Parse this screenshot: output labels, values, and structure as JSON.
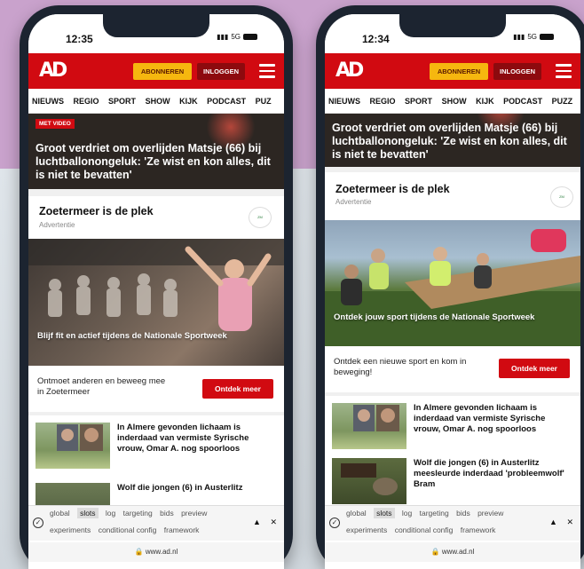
{
  "left": {
    "time": "12:35",
    "signal": "5G",
    "header": {
      "logo": "AD",
      "subscribe": "ABONNEREN",
      "login": "INLOGGEN"
    },
    "nav": [
      "NIEUWS",
      "REGIO",
      "SPORT",
      "SHOW",
      "KIJK",
      "PODCAST",
      "PUZ"
    ],
    "hero": {
      "badge": "MET VIDEO",
      "title": "Groot verdriet om overlijden Matsje (66) bij luchtballonongeluk: 'Ze wist en kon alles, dit is niet te bevatten'"
    },
    "ad": {
      "title": "Zoetermeer is de plek",
      "label": "Advertentie",
      "caption": "Blijf fit en actief tijdens de Nationale Sportweek",
      "cta_text": "Ontmoet anderen en beweeg mee in Zoetermeer",
      "cta_button": "Ontdek meer"
    },
    "articles": [
      {
        "title": "In Almere gevonden lichaam is inderdaad van vermiste Syrische vrouw, Omar A. nog spoorloos"
      },
      {
        "title": "Wolf die jongen (6) in Austerlitz"
      }
    ],
    "debug": {
      "row1": [
        "global",
        "slots",
        "log",
        "targeting",
        "bids",
        "preview"
      ],
      "row2": [
        "experiments",
        "conditional config",
        "framework"
      ],
      "active": "slots"
    },
    "url": "www.ad.nl"
  },
  "right": {
    "time": "12:34",
    "signal": "5G",
    "header": {
      "logo": "AD",
      "subscribe": "ABONNEREN",
      "login": "INLOGGEN"
    },
    "nav": [
      "NIEUWS",
      "REGIO",
      "SPORT",
      "SHOW",
      "KIJK",
      "PODCAST",
      "PUZZ"
    ],
    "hero": {
      "title": "Groot verdriet om overlijden Matsje (66) bij luchtballonongeluk: 'Ze wist en kon alles, dit is niet te bevatten'"
    },
    "ad": {
      "title": "Zoetermeer is de plek",
      "label": "Advertentie",
      "caption": "Ontdek jouw sport tijdens de Nationale Sportweek",
      "cta_text": "Ontdek een nieuwe sport en kom in beweging!",
      "cta_button": "Ontdek meer"
    },
    "articles": [
      {
        "title": "In Almere gevonden lichaam is inderdaad van vermiste Syrische vrouw, Omar A. nog spoorloos"
      },
      {
        "title": "Wolf die jongen (6) in Austerlitz meesleurde inderdaad 'probleemwolf' Bram"
      }
    ],
    "debug": {
      "row1": [
        "global",
        "slots",
        "log",
        "targeting",
        "bids",
        "preview"
      ],
      "row2": [
        "experiments",
        "conditional config",
        "framework"
      ],
      "active": "slots"
    },
    "url": "www.ad.nl"
  },
  "colors": {
    "brand_red": "#d10a11",
    "subscribe_yellow": "#f6b70f",
    "login_dark_red": "#8d0a0e"
  }
}
